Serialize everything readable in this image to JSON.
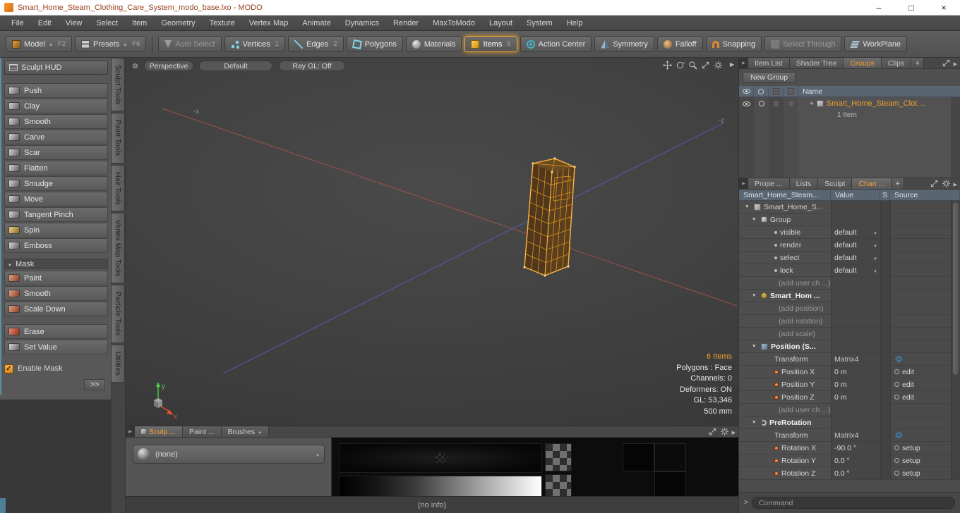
{
  "window": {
    "title": "Smart_Home_Steam_Clothing_Care_System_modo_base.lxo - MODO",
    "minimize": "–",
    "maximize": "□",
    "close": "×"
  },
  "menubar": [
    "File",
    "Edit",
    "View",
    "Select",
    "Item",
    "Geometry",
    "Texture",
    "Vertex Map",
    "Animate",
    "Dynamics",
    "Render",
    "MaxToModo",
    "Layout",
    "System",
    "Help"
  ],
  "toolbar": {
    "model": "Model",
    "model_key": "F2",
    "presets": "Presets",
    "presets_key": "F6",
    "auto_select": "Auto Select",
    "vertices": "Vertices",
    "vertices_key": "1",
    "edges": "Edges",
    "edges_key": "2",
    "polygons": "Polygons",
    "materials": "Materials",
    "items": "Items",
    "items_key": "5",
    "action_center": "Action Center",
    "symmetry": "Symmetry",
    "falloff": "Falloff",
    "snapping": "Snapping",
    "select_through": "Select Through",
    "workplane": "WorkPlane"
  },
  "sculpt_panel": {
    "hud": "Sculpt HUD",
    "tools": [
      "Push",
      "Clay",
      "Smooth",
      "Carve",
      "Scar",
      "Flatten",
      "Smudge",
      "Move",
      "Tangent Pinch",
      "Spin",
      "Emboss"
    ],
    "mask_header": "Mask",
    "mask_tools": [
      "Paint",
      "Smooth",
      "Scale Down"
    ],
    "edit_tools": [
      "Erase",
      "Set Value"
    ],
    "enable_mask": "Enable Mask",
    "more": ">>"
  },
  "tool_tabs": [
    "Sculpt Tools",
    "Paint Tools",
    "Hair Tools",
    "Vertex Map Tools",
    "Particle Tools",
    "Utilities"
  ],
  "viewport": {
    "view": "Perspective",
    "shading": "Default",
    "raygl": "Ray GL: Off",
    "neg_x": "-x",
    "neg_z": "-z",
    "stats": [
      "6 Items",
      "Polygons : Face",
      "Channels: 0",
      "Deformers: ON",
      "GL: 53,346",
      "500 mm"
    ],
    "axis_x": "x",
    "axis_y": "y"
  },
  "groups_panel": {
    "tabs": [
      "Item List",
      "Shader Tree",
      "Groups",
      "Clips"
    ],
    "add": "+",
    "new_group": "New Group",
    "name_col": "Name",
    "item_name": "Smart_Home_Steam_Clot ...",
    "item_sub": "1 Item"
  },
  "channels_panel": {
    "tabs": [
      "Prope ...",
      "Lists",
      "Sculpt",
      "Chan ..."
    ],
    "add": "+",
    "cols": {
      "name": "Smart_Home_Steam...",
      "value": "Value",
      "s": "S",
      "source": "Source"
    },
    "rows": [
      {
        "name": "Smart_Home_S...",
        "value": "",
        "source": ""
      },
      {
        "name": "Group",
        "value": "",
        "source": ""
      },
      {
        "name": "visible",
        "value": "default",
        "source": ""
      },
      {
        "name": "render",
        "value": "default",
        "source": ""
      },
      {
        "name": "select",
        "value": "default",
        "source": ""
      },
      {
        "name": "lock",
        "value": "default",
        "source": ""
      },
      {
        "name": "(add user ch ...)",
        "value": "",
        "source": ""
      },
      {
        "name": "Smart_Hom ...",
        "value": "",
        "source": ""
      },
      {
        "name": "(add position)",
        "value": "",
        "source": ""
      },
      {
        "name": "(add rotation)",
        "value": "",
        "source": ""
      },
      {
        "name": "(add scale)",
        "value": "",
        "source": ""
      },
      {
        "name": "Position (S...",
        "value": "",
        "source": ""
      },
      {
        "name": "Transform",
        "value": "Matrix4",
        "source": ""
      },
      {
        "name": "Position X",
        "value": "0 m",
        "source": "edit"
      },
      {
        "name": "Position Y",
        "value": "0 m",
        "source": "edit"
      },
      {
        "name": "Position Z",
        "value": "0 m",
        "source": "edit"
      },
      {
        "name": "(add user ch ...)",
        "value": "",
        "source": ""
      },
      {
        "name": "PreRotation",
        "value": "",
        "source": ""
      },
      {
        "name": "Transform",
        "value": "Matrix4",
        "source": ""
      },
      {
        "name": "Rotation X",
        "value": "-90.0 °",
        "source": "setup"
      },
      {
        "name": "Rotation Y",
        "value": "0.0 °",
        "source": "setup"
      },
      {
        "name": "Rotation Z",
        "value": "0.0 °",
        "source": "setup"
      }
    ]
  },
  "brush_panel": {
    "tabs": [
      "Sculp ...",
      "Paint ...",
      "Brushes"
    ],
    "preset": "(none)"
  },
  "statusbar": "(no info)",
  "command": {
    "prompt": ">",
    "placeholder": "Command"
  },
  "colors": {
    "accent_orange": "#f0a030",
    "header_blue_gray": "#5a6572",
    "gear_blue": "#3f9fe0",
    "model_wire": "#f5a623",
    "axis_red": "#b0544a",
    "axis_blue": "#5560b8",
    "axis_green": "#4ad04a"
  }
}
